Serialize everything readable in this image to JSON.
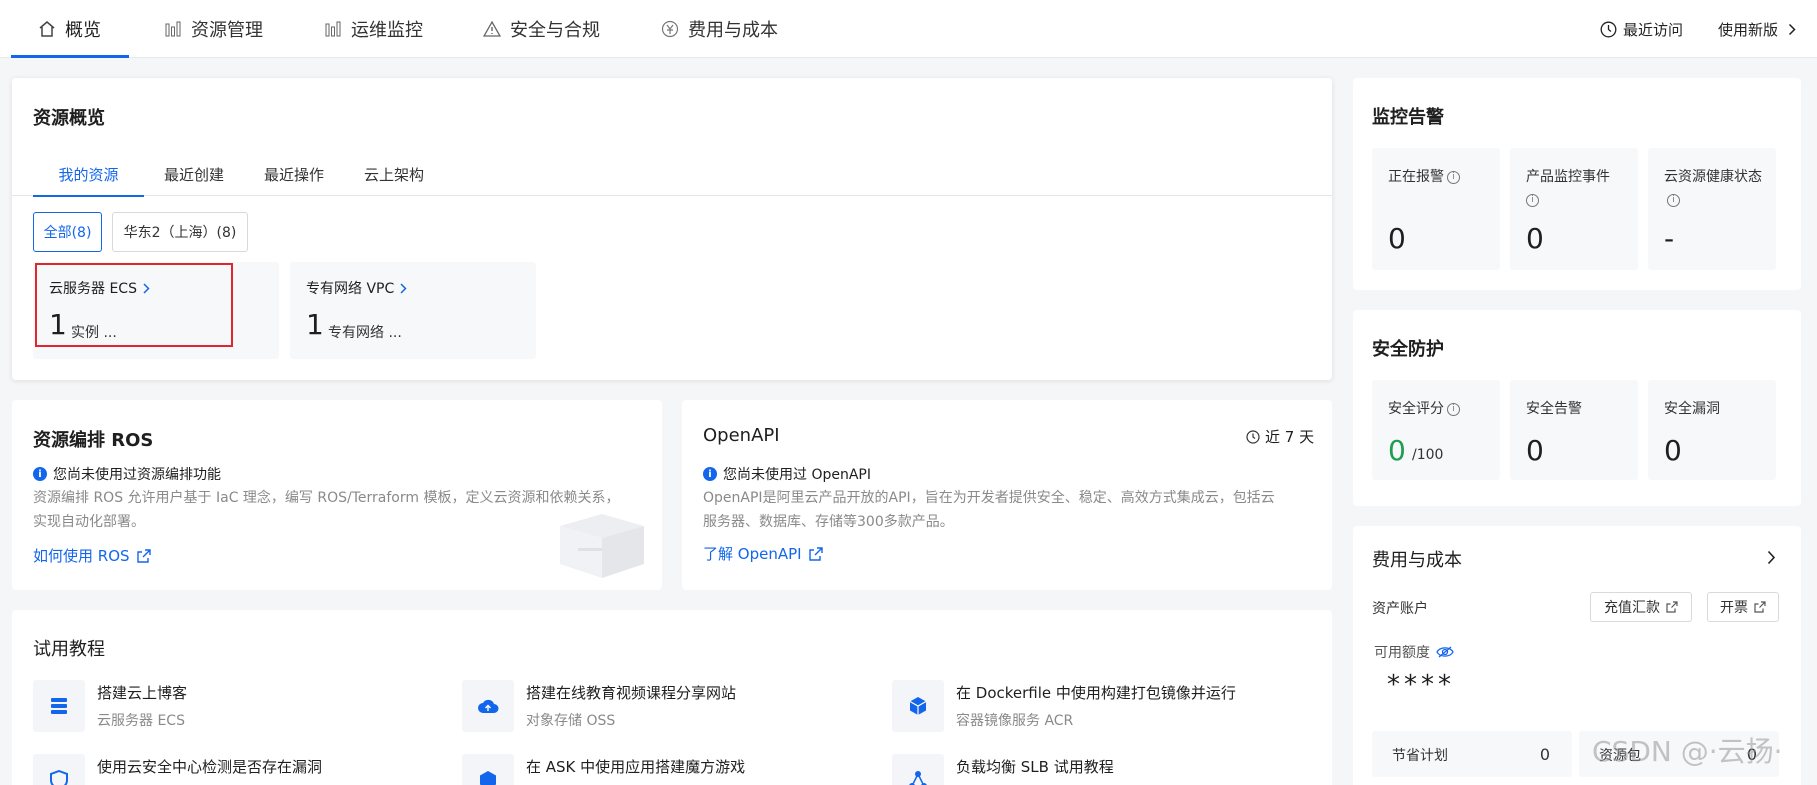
{
  "nav": {
    "tabs": [
      {
        "label": "概览",
        "icon": "home-icon"
      },
      {
        "label": "资源管理",
        "icon": "bar-chart-icon"
      },
      {
        "label": "运维监控",
        "icon": "bar-chart-icon"
      },
      {
        "label": "安全与合规",
        "icon": "warning-icon"
      },
      {
        "label": "费用与成本",
        "icon": "currency-icon"
      }
    ],
    "recent": "最近访问",
    "new_version": "使用新版"
  },
  "overview": {
    "title": "资源概览",
    "tabs": [
      "我的资源",
      "最近创建",
      "最近操作",
      "云上架构"
    ],
    "filters": [
      "全部(8)",
      "华东2（上海）(8)"
    ],
    "resources": [
      {
        "name": "云服务器 ECS",
        "count": "1",
        "unit": "实例 ..."
      },
      {
        "name": "专有网络 VPC",
        "count": "1",
        "unit": "专有网络 ..."
      }
    ]
  },
  "ros": {
    "title": "资源编排 ROS",
    "notice": "您尚未使用过资源编排功能",
    "desc1": "资源编排 ROS 允许用户基于 IaC 理念，编写 ROS/Terraform 模板，定义云资源和依赖关系，",
    "desc2": "实现自动化部署。",
    "link": "如何使用 ROS"
  },
  "openapi": {
    "title": "OpenAPI",
    "period": "近 7 天",
    "notice": "您尚未使用过 OpenAPI",
    "desc1": "OpenAPI是阿里云产品开放的API，旨在为开发者提供安全、稳定、高效方式集成云，包括云",
    "desc2": "服务器、数据库、存储等300多款产品。",
    "link": "了解 OpenAPI"
  },
  "tutorials": {
    "title": "试用教程",
    "items": [
      {
        "title": "搭建云上博客",
        "sub": "云服务器 ECS",
        "icon": "server-icon"
      },
      {
        "title": "搭建在线教育视频课程分享网站",
        "sub": "对象存储 OSS",
        "icon": "cloud-upload-icon"
      },
      {
        "title": "在 Dockerfile 中使用构建打包镜像并运行",
        "sub": "容器镜像服务 ACR",
        "icon": "cube-icon"
      },
      {
        "title": "使用云安全中心检测是否存在漏洞",
        "sub": "",
        "icon": "shield-icon"
      },
      {
        "title": "在 ASK 中使用应用搭建魔方游戏",
        "sub": "",
        "icon": "hexagon-icon"
      },
      {
        "title": "负载均衡 SLB 试用教程",
        "sub": "",
        "icon": "network-icon"
      }
    ]
  },
  "monitor": {
    "title": "监控告警",
    "stats": [
      {
        "label": "正在报警",
        "value": "0"
      },
      {
        "label": "产品监控事件",
        "value": "0"
      },
      {
        "label": "云资源健康状态",
        "value": "-"
      }
    ]
  },
  "security": {
    "title": "安全防护",
    "stats": [
      {
        "label": "安全评分",
        "value": "0",
        "suffix": "/100"
      },
      {
        "label": "安全告警",
        "value": "0"
      },
      {
        "label": "安全漏洞",
        "value": "0"
      }
    ],
    "score_color": "#1e9e4f"
  },
  "cost": {
    "title": "费用与成本",
    "account_label": "资产账户",
    "recharge": "充值汇款",
    "invoice": "开票",
    "available_label": "可用额度",
    "available_value": "****",
    "plans": [
      {
        "label": "节省计划",
        "value": "0"
      },
      {
        "label": "资源包",
        "value": "0"
      }
    ]
  },
  "watermark": "CSDN @·云扬·"
}
